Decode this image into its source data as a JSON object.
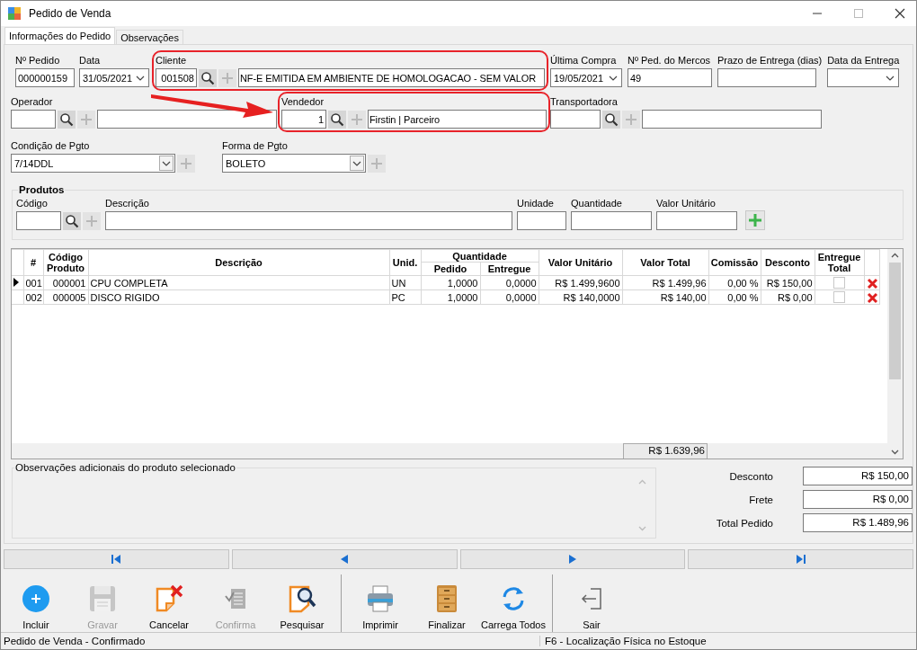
{
  "window": {
    "title": "Pedido de Venda"
  },
  "tabs": [
    {
      "label": "Informações do Pedido",
      "selected": true
    },
    {
      "label": "Observações",
      "selected": false
    }
  ],
  "form_rows": [
    {
      "fields": [
        {
          "label": "Nº Pedido",
          "kind": "text",
          "value": "000000159",
          "highlighted": false
        },
        {
          "label": "Data",
          "kind": "combo",
          "value": "31/05/2021",
          "highlighted": false
        },
        {
          "label": "Cliente",
          "kind": "lookup",
          "value": "001508",
          "description": "NF-E EMITIDA EM AMBIENTE DE HOMOLOGACAO - SEM VALOR",
          "highlighted": true
        },
        {
          "label": "Última Compra",
          "kind": "combo",
          "value": "19/05/2021",
          "highlighted": false
        },
        {
          "label": "Nº Ped. do Mercos",
          "kind": "text",
          "value": "49",
          "highlighted": false
        },
        {
          "label": "Prazo de Entrega (dias)",
          "kind": "text",
          "highlighted": false
        },
        {
          "label": "Data da Entrega",
          "kind": "combo",
          "highlighted": false
        }
      ]
    },
    {
      "fields": [
        {
          "label": "Operador",
          "kind": "lookup",
          "highlighted": false
        },
        {
          "label": "Vendedor",
          "kind": "lookup",
          "value": "1",
          "description": "Firstin | Parceiro",
          "highlighted": true
        },
        {
          "label": "Transportadora",
          "kind": "lookup",
          "highlighted": false
        }
      ]
    },
    {
      "fields": [
        {
          "label": "Condição de Pgto",
          "kind": "combo_add",
          "value": "7/14DDL",
          "highlighted": false
        },
        {
          "label": "Forma de Pgto",
          "kind": "combo_add",
          "value": "BOLETO",
          "highlighted": false
        }
      ]
    }
  ],
  "products": {
    "title": "Produtos",
    "labels": [
      "Código",
      "Descrição",
      "Unidade",
      "Quantidade",
      "Valor Unitário"
    ]
  },
  "grid": {
    "headers": {
      "num": "#",
      "code": "Código Produto",
      "description": "Descrição",
      "unit": "Unid.",
      "qty": "Quantidade",
      "qty_ordered": "Pedido",
      "qty_delivered": "Entregue",
      "unit_price": "Valor Unitário",
      "total": "Valor Total",
      "commission": "Comissão",
      "discount": "Desconto",
      "delivered": "Entregue Total"
    },
    "rows": [
      {
        "num": "001",
        "code": "000001",
        "description": "CPU COMPLETA",
        "unit": "UN",
        "qty_ordered": "1,0000",
        "qty_delivered": "0,0000",
        "unit_price": "R$ 1.499,9600",
        "total": "R$ 1.499,96",
        "commission": "0,00 %",
        "discount": "R$ 150,00",
        "delivered": false,
        "current": true
      },
      {
        "num": "002",
        "code": "000005",
        "description": "DISCO RIGIDO",
        "unit": "PC",
        "qty_ordered": "1,0000",
        "qty_delivered": "0,0000",
        "unit_price": "R$ 140,0000",
        "total": "R$ 140,00",
        "commission": "0,00 %",
        "discount": "R$ 0,00",
        "delivered": false,
        "current": false
      }
    ],
    "sum_total": "R$ 1.639,96"
  },
  "notes": {
    "title": "Observações adicionais do produto selecionado"
  },
  "totals": [
    {
      "label": "Desconto",
      "value": "R$ 150,00"
    },
    {
      "label": "Frete",
      "value": "R$ 0,00"
    },
    {
      "label": "Total Pedido",
      "value": "R$ 1.489,96"
    }
  ],
  "toolbar_groups": [
    {
      "buttons": [
        {
          "label": "Incluir",
          "disabled": false
        },
        {
          "label": "Gravar",
          "disabled": true
        },
        {
          "label": "Cancelar",
          "disabled": false
        },
        {
          "label": "Confirma",
          "disabled": true
        },
        {
          "label": "Pesquisar",
          "disabled": false
        }
      ]
    },
    {
      "buttons": [
        {
          "label": "Imprimir",
          "disabled": false
        },
        {
          "label": "Finalizar",
          "disabled": false
        },
        {
          "label": "Carrega Todos",
          "disabled": false
        }
      ]
    },
    {
      "buttons": [
        {
          "label": "Sair",
          "disabled": false
        }
      ]
    }
  ],
  "status_bar": [
    "Pedido de Venda - Confirmado",
    "F6 - Localização Física no Estoque"
  ]
}
